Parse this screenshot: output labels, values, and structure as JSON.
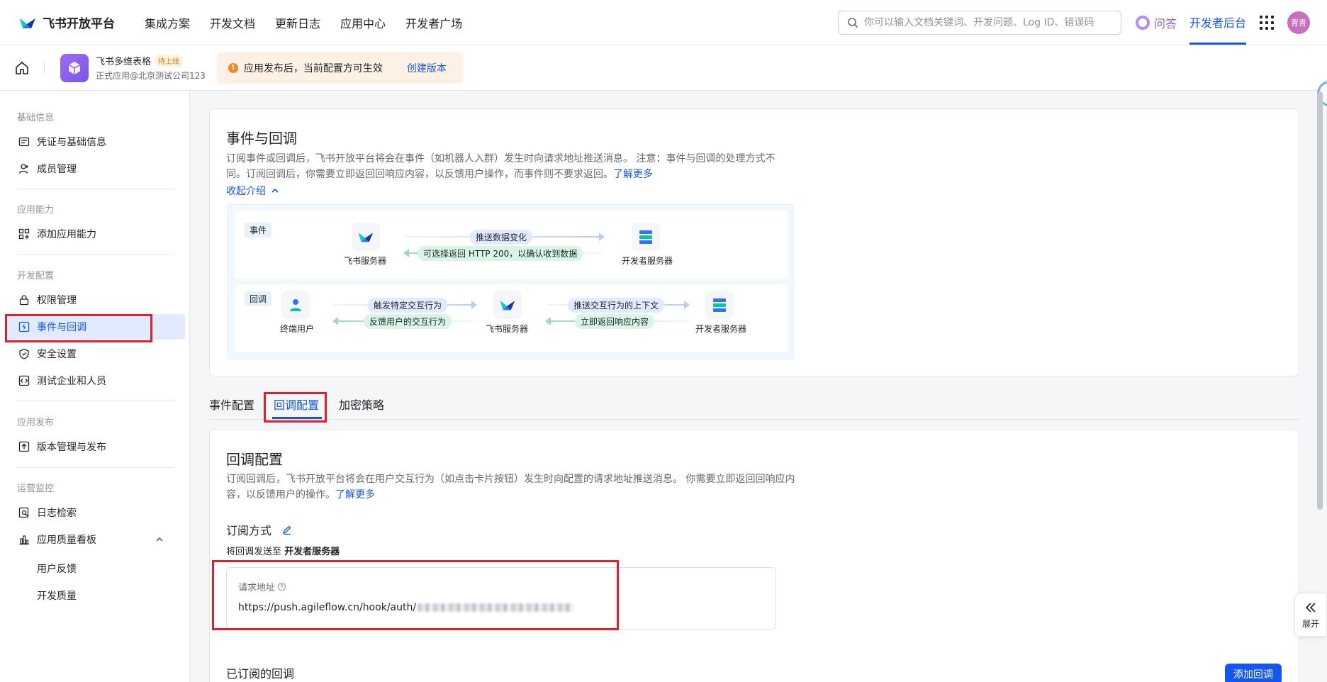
{
  "topnav": {
    "brand": "飞书开放平台",
    "menu": [
      "集成方案",
      "开发文档",
      "更新日志",
      "应用中心",
      "开发者广场"
    ],
    "search_placeholder": "你可以输入文档关键词、开发问题、Log ID、错误码",
    "qa": "问答",
    "dev_console": "开发者后台",
    "avatar": "青青"
  },
  "appbar": {
    "app_name": "飞书多维表格",
    "badge": "待上线",
    "app_sub": "正式应用@北京测试公司123",
    "notice": "应用发布后，当前配置方可生效",
    "notice_link": "创建版本"
  },
  "sidebar": {
    "groups": [
      "基础信息",
      "应用能力",
      "开发配置",
      "应用发布",
      "运营监控"
    ],
    "items": [
      "凭证与基础信息",
      "成员管理",
      "添加应用能力",
      "权限管理",
      "事件与回调",
      "安全设置",
      "测试企业和人员",
      "版本管理与发布",
      "日志检索",
      "应用质量看板"
    ],
    "sub_items": [
      "用户反馈",
      "开发质量"
    ]
  },
  "intro": {
    "title": "事件与回调",
    "desc_line1": "订阅事件或回调后，飞书开放平台将会在事件（如机器人入群）发生时向请求地址推送消息。 注意：事件与回调的处理方式不",
    "desc_line2": "同。订阅回调后，你需要立即返回回响应内容，以反馈用户操作，而事件则不要求返回。",
    "learn_more": "了解更多",
    "collapse": "收起介绍",
    "event_tag": "事件",
    "callback_tag": "回调",
    "feishu_server": "飞书服务器",
    "dev_server": "开发者服务器",
    "end_user": "终端用户",
    "push_data": "推送数据变化",
    "return_200": "可选择返回 HTTP 200，以确认收到数据",
    "trigger": "触发特定交互行为",
    "feedback": "反馈用户的交互行为",
    "push_context": "推送交互行为的上下文",
    "return_resp": "立即返回响应内容"
  },
  "tabs": [
    "事件配置",
    "回调配置",
    "加密策略"
  ],
  "callback": {
    "title": "回调配置",
    "desc_line1": "订阅回调后，飞书开放平台将会在用户交互行为（如点击卡片按钮）发生时向配置的请求地址推送消息。 你需要立即返回回响应内",
    "desc_line2": "容，以反馈用户的操作。",
    "learn_more": "了解更多",
    "subscribe_mode": "订阅方式",
    "send_to_prefix": "将回调发送至 ",
    "send_to_target": "开发者服务器",
    "url_label": "请求地址",
    "url_value": "https://push.agileflow.cn/hook/auth/",
    "subscribed": "已订阅的回调",
    "add_button": "添加回调",
    "expand": "展开"
  },
  "colors": {
    "primary": "#1456f0",
    "highlight": "#e0202c"
  }
}
